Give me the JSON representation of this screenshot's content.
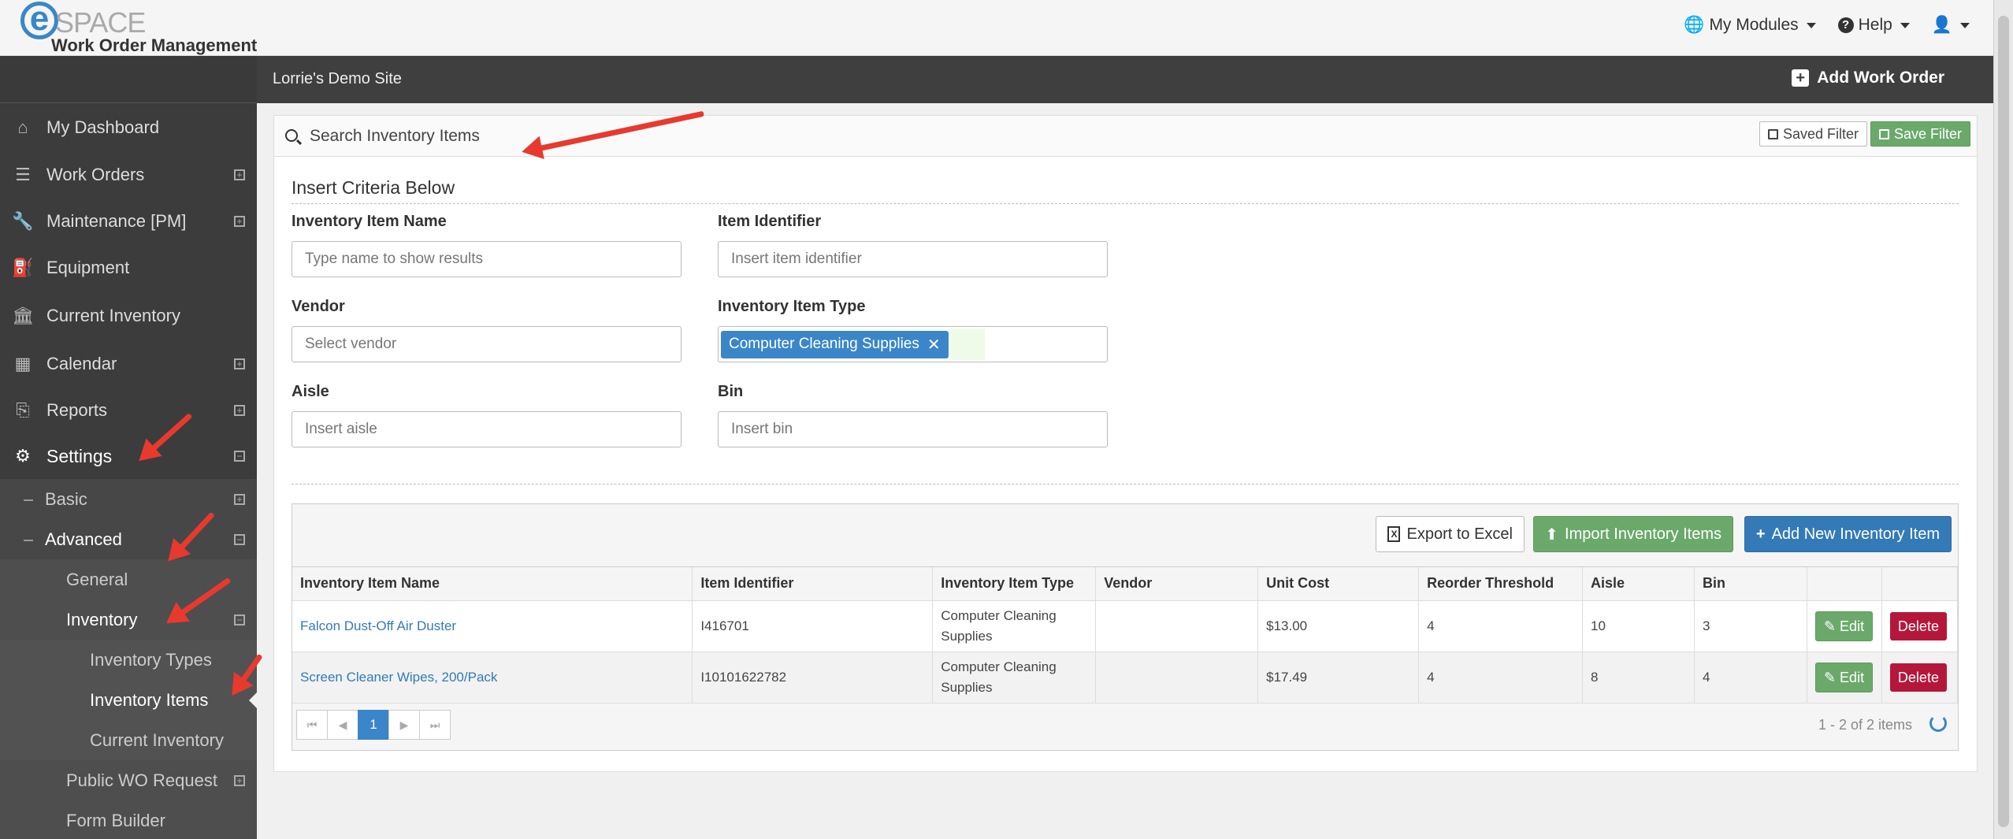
{
  "app": {
    "logo_e": "e",
    "logo_text": "SPACE",
    "subtitle": "Work Order Management"
  },
  "top_menu": {
    "modules": "My Modules",
    "help": "Help"
  },
  "site": {
    "name": "Lorrie's Demo Site",
    "add_work_order": "Add Work Order"
  },
  "sidebar": {
    "items": [
      {
        "label": "My Dashboard",
        "icon": "home-icon",
        "glyph": "⌂"
      },
      {
        "label": "Work Orders",
        "icon": "list-icon",
        "glyph": "☰"
      },
      {
        "label": "Maintenance [PM]",
        "icon": "wrench-icon",
        "glyph": "🔧"
      },
      {
        "label": "Equipment",
        "icon": "extinguisher-icon",
        "glyph": "⛽"
      },
      {
        "label": "Current Inventory",
        "icon": "bank-icon",
        "glyph": "🏛"
      },
      {
        "label": "Calendar",
        "icon": "calendar-icon",
        "glyph": "▦"
      },
      {
        "label": "Reports",
        "icon": "reports-icon",
        "glyph": "⎘"
      },
      {
        "label": "Settings",
        "icon": "gear-icon",
        "glyph": "⚙"
      }
    ],
    "sub": {
      "basic": "Basic",
      "advanced": "Advanced",
      "general": "General",
      "inventory": "Inventory",
      "inventory_types": "Inventory Types",
      "inventory_items": "Inventory Items",
      "current_inventory": "Current Inventory",
      "public_wo_request": "Public WO Request",
      "form_builder": "Form Builder"
    }
  },
  "search": {
    "title": "Search Inventory Items",
    "saved_filter": "Saved Filter",
    "save_filter": "Save Filter",
    "criteria_title": "Insert Criteria Below",
    "fields": {
      "item_name_label": "Inventory Item Name",
      "item_name_placeholder": "Type name to show results",
      "identifier_label": "Item Identifier",
      "identifier_placeholder": "Insert item identifier",
      "vendor_label": "Vendor",
      "vendor_placeholder": "Select vendor",
      "type_label": "Inventory Item Type",
      "type_selected": "Computer Cleaning Supplies",
      "aisle_label": "Aisle",
      "aisle_placeholder": "Insert aisle",
      "bin_label": "Bin",
      "bin_placeholder": "Insert bin"
    }
  },
  "grid": {
    "export": "Export to Excel",
    "import": "Import Inventory Items",
    "add_new": "Add New Inventory Item",
    "columns": [
      "Inventory Item Name",
      "Item Identifier",
      "Inventory Item Type",
      "Vendor",
      "Unit Cost",
      "Reorder Threshold",
      "Aisle",
      "Bin"
    ],
    "rows": [
      {
        "name": "Falcon Dust-Off Air Duster",
        "identifier": "I416701",
        "type": "Computer Cleaning Supplies",
        "vendor": "",
        "cost": "$13.00",
        "reorder": "4",
        "aisle": "10",
        "bin": "3"
      },
      {
        "name": "Screen Cleaner Wipes, 200/Pack",
        "identifier": "I10101622782",
        "type": "Computer Cleaning Supplies",
        "vendor": "",
        "cost": "$17.49",
        "reorder": "4",
        "aisle": "8",
        "bin": "4"
      }
    ],
    "edit_label": "Edit",
    "delete_label": "Delete",
    "page": "1",
    "page_info": "1 - 2 of 2 items"
  },
  "colors": {
    "accent_blue": "#3a86c8",
    "green": "#6ba96b",
    "danger": "#b5173a",
    "arrow_red": "#e8392f"
  }
}
